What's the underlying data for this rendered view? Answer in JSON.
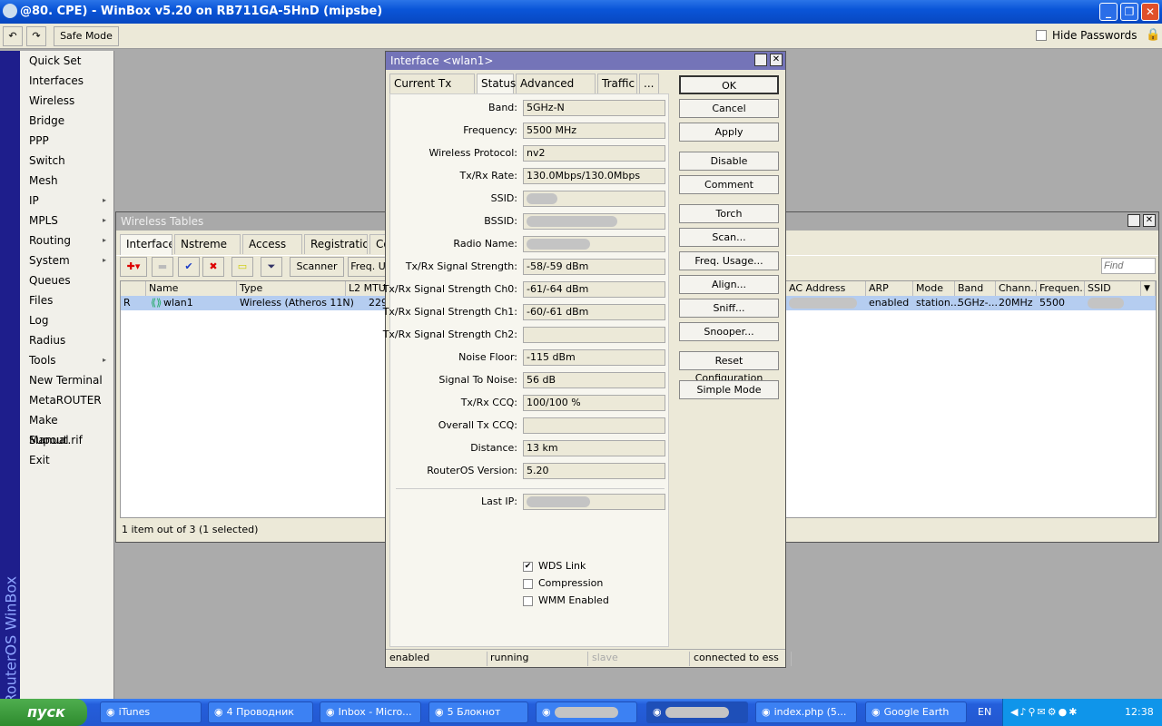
{
  "titlebar": {
    "title": "@80.      CPE) - WinBox v5.20 on RB711GA-5HnD (mipsbe)"
  },
  "toolbar": {
    "undo": "↶",
    "redo": "↷",
    "safe_mode": "Safe Mode",
    "hide_passwords": "Hide Passwords"
  },
  "brand": "RouterOS WinBox",
  "menu": [
    {
      "label": "Quick Set"
    },
    {
      "label": "Interfaces"
    },
    {
      "label": "Wireless"
    },
    {
      "label": "Bridge"
    },
    {
      "label": "PPP"
    },
    {
      "label": "Switch"
    },
    {
      "label": "Mesh"
    },
    {
      "label": "IP",
      "sub": "▸"
    },
    {
      "label": "MPLS",
      "sub": "▸"
    },
    {
      "label": "Routing",
      "sub": "▸"
    },
    {
      "label": "System",
      "sub": "▸"
    },
    {
      "label": "Queues"
    },
    {
      "label": "Files"
    },
    {
      "label": "Log"
    },
    {
      "label": "Radius"
    },
    {
      "label": "Tools",
      "sub": "▸"
    },
    {
      "label": "New Terminal"
    },
    {
      "label": "MetaROUTER"
    },
    {
      "label": "Make Supout.rif"
    },
    {
      "label": "Manual"
    },
    {
      "label": "Exit"
    }
  ],
  "wireless_tables": {
    "title": "Wireless Tables",
    "tabs": [
      "Interfaces",
      "Nstreme Dual",
      "Access List",
      "Registration",
      "Con"
    ],
    "scanner": "Scanner",
    "freq": "Freq. U",
    "find_placeholder": "Find",
    "headers": [
      "Name",
      "Type",
      "L2 MTU",
      "AC Address",
      "ARP",
      "Mode",
      "Band",
      "Chann...",
      "Frequen...",
      "SSID"
    ],
    "row": {
      "flag": "R",
      "name": "wlan1",
      "type": "Wireless (Atheros 11N)",
      "mtu": "229",
      "arp": "enabled",
      "mode": "station...",
      "band": "5GHz-...",
      "channel": "20MHz",
      "frequency": "5500"
    },
    "status": "1 item out of 3 (1 selected)"
  },
  "dialog": {
    "title": "Interface <wlan1>",
    "tabs": [
      "Current Tx Power",
      "Status",
      "Advanced Status",
      "Traffic",
      "..."
    ],
    "fields": [
      {
        "label": "Band:",
        "value": "5GHz-N"
      },
      {
        "label": "Frequency:",
        "value": "5500 MHz"
      },
      {
        "label": "Wireless Protocol:",
        "value": "nv2"
      },
      {
        "label": "Tx/Rx Rate:",
        "value": "130.0Mbps/130.0Mbps"
      },
      {
        "label": "SSID:",
        "value": ""
      },
      {
        "label": "BSSID:",
        "value": ""
      },
      {
        "label": "Radio Name:",
        "value": ""
      },
      {
        "label": "Tx/Rx Signal Strength:",
        "value": "-58/-59 dBm"
      },
      {
        "label": "Tx/Rx Signal Strength Ch0:",
        "value": "-61/-64 dBm"
      },
      {
        "label": "Tx/Rx Signal Strength Ch1:",
        "value": "-60/-61 dBm"
      },
      {
        "label": "Tx/Rx Signal Strength Ch2:",
        "value": ""
      },
      {
        "label": "Noise Floor:",
        "value": "-115 dBm"
      },
      {
        "label": "Signal To Noise:",
        "value": "56 dB"
      },
      {
        "label": "Tx/Rx CCQ:",
        "value": "100/100 %"
      },
      {
        "label": "Overall Tx CCQ:",
        "value": ""
      },
      {
        "label": "Distance:",
        "value": "13 km"
      },
      {
        "label": "RouterOS Version:",
        "value": "5.20"
      }
    ],
    "last_ip_label": "Last IP:",
    "checks": [
      {
        "label": "WDS Link",
        "checked": true
      },
      {
        "label": "Compression",
        "checked": false
      },
      {
        "label": "WMM Enabled",
        "checked": false
      }
    ],
    "buttons": [
      "OK",
      "Cancel",
      "Apply",
      "Disable",
      "Comment",
      "Torch",
      "Scan...",
      "Freq. Usage...",
      "Align...",
      "Sniff...",
      "Snooper...",
      "Reset Configuration",
      "Simple Mode"
    ],
    "status": [
      "enabled",
      "running",
      "slave",
      "connected to ess"
    ]
  },
  "taskbar": {
    "start": "пуск",
    "tasks": [
      "iTunes",
      "4 Проводник",
      "Inbox - Micro...",
      "5 Блокнот",
      "",
      "",
      "index.php (5...",
      "Google Earth"
    ],
    "lang": "EN",
    "clock": "12:38"
  }
}
